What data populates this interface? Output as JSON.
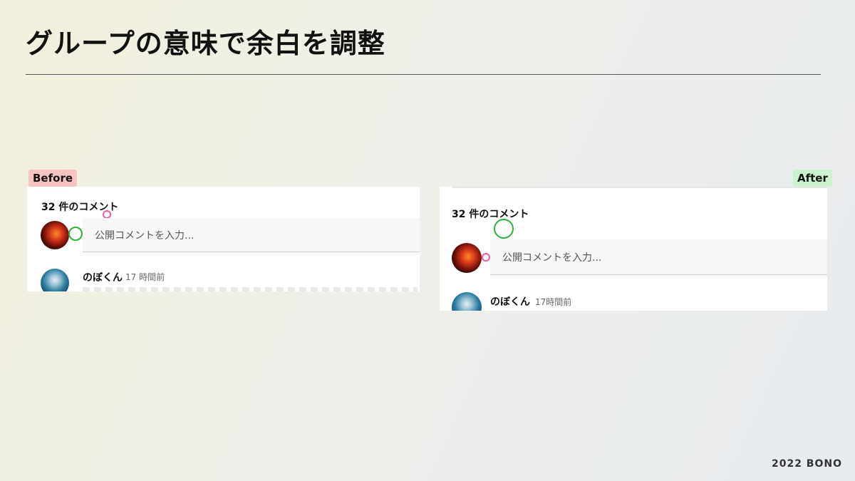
{
  "slide": {
    "title": "グループの意味で余白を調整",
    "footer": "2022 BONO"
  },
  "before": {
    "tag": "Before",
    "comment_count": "32 件のコメント",
    "input_placeholder": "公開コメントを入力...",
    "comment": {
      "user": "のぼくん",
      "time": "17 時間前"
    }
  },
  "after": {
    "tag": "After",
    "comment_count": "32 件のコメント",
    "input_placeholder": "公開コメントを入力...",
    "comment": {
      "user": "のぼくん",
      "time": "17時間前"
    }
  },
  "colors": {
    "before_tag": "#f7c3c3",
    "after_tag": "#cdf2cf",
    "marker_green": "#27b33c",
    "marker_pink": "#ee5aa6"
  }
}
